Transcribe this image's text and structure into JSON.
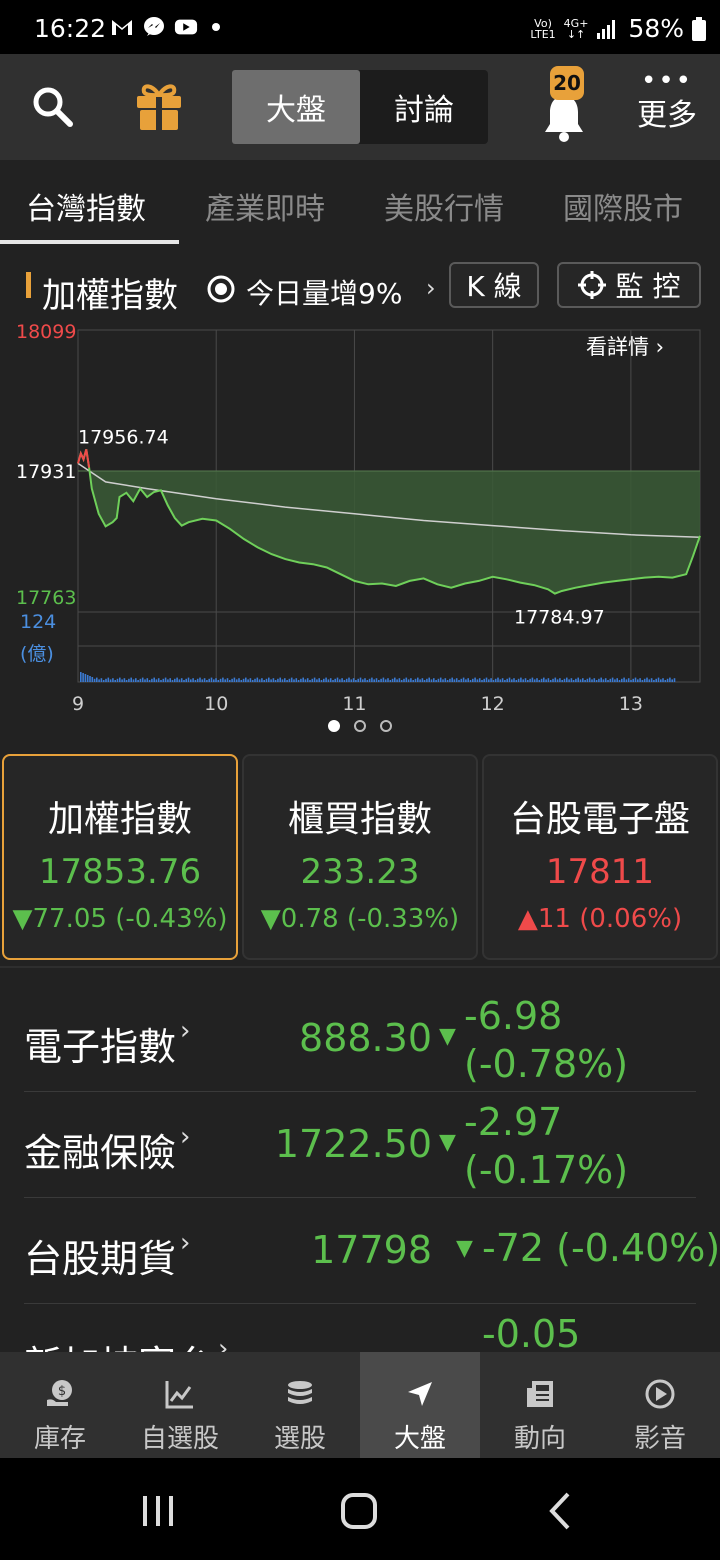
{
  "status_bar": {
    "time": "16:22",
    "icons": [
      "gmail-icon",
      "messenger-icon",
      "youtube-icon",
      "dot-icon"
    ],
    "net_top": "Vo)",
    "net_bottom": "LTE1",
    "net_4g": "4G+",
    "battery": "58%"
  },
  "header": {
    "segments": [
      "大盤",
      "討論"
    ],
    "active_segment": "大盤",
    "notification_count": "20",
    "more_dots": "•••",
    "more_label": "更多"
  },
  "tabs": [
    "台灣指數",
    "產業即時",
    "美股行情",
    "國際股市"
  ],
  "chart_header": {
    "title": "加權指數",
    "volume_note": "今日量增9%",
    "arrow": "›",
    "kline_button": "K 線",
    "monitor_button": "監 控"
  },
  "chart_data": {
    "type": "line",
    "title": "",
    "link_text": "看詳情",
    "link_arrow": "›",
    "x_ticks": [
      "9",
      "10",
      "11",
      "12",
      "13"
    ],
    "y_labels": {
      "high": "18099",
      "ref": "17931",
      "low": "17763"
    },
    "volume_labels": {
      "max": "124",
      "unit": "(億)"
    },
    "annotations": {
      "max_label": "17956.74",
      "min_label": "17784.97"
    },
    "xlim": [
      9,
      13.5
    ],
    "ylim": [
      17763,
      18099
    ],
    "reference": 17931,
    "price_series": [
      [
        9.0,
        17940
      ],
      [
        9.02,
        17952
      ],
      [
        9.04,
        17945
      ],
      [
        9.06,
        17956.74
      ],
      [
        9.08,
        17935
      ],
      [
        9.1,
        17910
      ],
      [
        9.15,
        17880
      ],
      [
        9.2,
        17865
      ],
      [
        9.25,
        17870
      ],
      [
        9.28,
        17875
      ],
      [
        9.3,
        17900
      ],
      [
        9.35,
        17905
      ],
      [
        9.4,
        17895
      ],
      [
        9.45,
        17910
      ],
      [
        9.5,
        17900
      ],
      [
        9.55,
        17906
      ],
      [
        9.6,
        17908
      ],
      [
        9.65,
        17890
      ],
      [
        9.7,
        17875
      ],
      [
        9.75,
        17866
      ],
      [
        9.8,
        17870
      ],
      [
        9.9,
        17874
      ],
      [
        10.0,
        17872
      ],
      [
        10.1,
        17862
      ],
      [
        10.2,
        17850
      ],
      [
        10.3,
        17840
      ],
      [
        10.4,
        17832
      ],
      [
        10.5,
        17826
      ],
      [
        10.6,
        17822
      ],
      [
        10.7,
        17820
      ],
      [
        10.8,
        17816
      ],
      [
        10.9,
        17808
      ],
      [
        11.0,
        17800
      ],
      [
        11.1,
        17796
      ],
      [
        11.2,
        17797
      ],
      [
        11.3,
        17794
      ],
      [
        11.4,
        17800
      ],
      [
        11.5,
        17803
      ],
      [
        11.6,
        17796
      ],
      [
        11.7,
        17792
      ],
      [
        11.8,
        17797
      ],
      [
        11.9,
        17800
      ],
      [
        12.0,
        17805
      ],
      [
        12.1,
        17802
      ],
      [
        12.2,
        17798
      ],
      [
        12.3,
        17795
      ],
      [
        12.4,
        17790
      ],
      [
        12.45,
        17784.97
      ],
      [
        12.5,
        17788
      ],
      [
        12.6,
        17792
      ],
      [
        12.7,
        17795
      ],
      [
        12.8,
        17798
      ],
      [
        12.9,
        17800
      ],
      [
        13.0,
        17802
      ],
      [
        13.1,
        17804
      ],
      [
        13.2,
        17805
      ],
      [
        13.3,
        17804
      ],
      [
        13.4,
        17808
      ],
      [
        13.45,
        17830
      ],
      [
        13.5,
        17853.76
      ]
    ],
    "avg_series": [
      [
        9.0,
        17940
      ],
      [
        9.2,
        17918
      ],
      [
        9.5,
        17910
      ],
      [
        10.0,
        17898
      ],
      [
        10.5,
        17888
      ],
      [
        11.0,
        17880
      ],
      [
        11.5,
        17872
      ],
      [
        12.0,
        17866
      ],
      [
        12.5,
        17860
      ],
      [
        13.0,
        17855
      ],
      [
        13.5,
        17852
      ]
    ],
    "colors": {
      "price": "#6fd05a",
      "fill": "#3a5a36",
      "avg": "#cfcfcf",
      "volume": "#3b7bd4",
      "grid": "#4a4a4a"
    }
  },
  "pager": {
    "count": 3,
    "active": 0
  },
  "index_cards": [
    {
      "name": "加權指數",
      "value": "17853.76",
      "change": "▼77.05 (-0.43%)",
      "direction": "down"
    },
    {
      "name": "櫃買指數",
      "value": "233.23",
      "change": "▼0.78 (-0.33%)",
      "direction": "down"
    },
    {
      "name": "台股電子盤",
      "value": "17811",
      "change": "▲11 (0.06%)",
      "direction": "up"
    }
  ],
  "sector_rows": [
    {
      "name": "電子指數",
      "chev": "›",
      "value": "888.30",
      "tri": "▼",
      "change1": "-6.98",
      "change2": "(-0.78%)"
    },
    {
      "name": "金融保險",
      "chev": "›",
      "value": "1722.50",
      "tri": "▼",
      "change1": "-2.97",
      "change2": "(-0.17%)"
    },
    {
      "name": "台股期貨",
      "chev": "›",
      "value": "17798",
      "tri": "▼",
      "change1": "-72 (-0.40%)",
      "change2": ""
    },
    {
      "name": "新加坡富台",
      "chev": "›",
      "value": "",
      "tri": "",
      "change1": "-0.05",
      "change2": ""
    }
  ],
  "bottom_nav": [
    {
      "label": "庫存",
      "icon": "coins-icon"
    },
    {
      "label": "自選股",
      "icon": "trend-chart-icon"
    },
    {
      "label": "選股",
      "icon": "stack-icon"
    },
    {
      "label": "大盤",
      "icon": "navigation-arrow-icon"
    },
    {
      "label": "動向",
      "icon": "newspaper-icon"
    },
    {
      "label": "影音",
      "icon": "play-circle-icon"
    }
  ],
  "active_nav": "大盤"
}
